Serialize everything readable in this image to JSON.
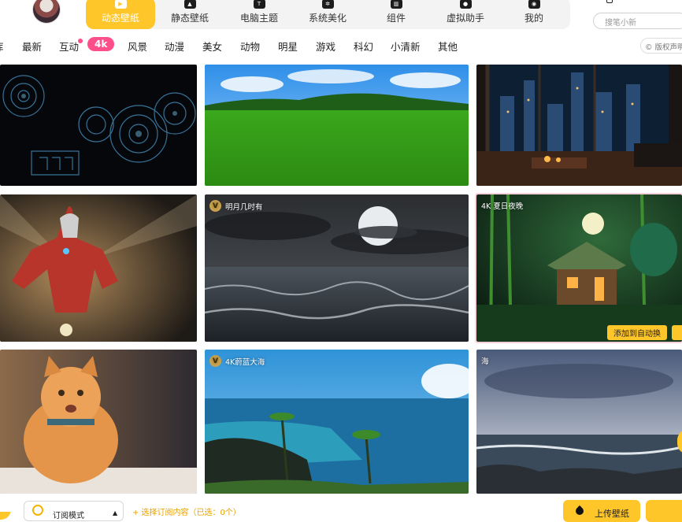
{
  "nav": {
    "items": [
      {
        "label": "动态壁纸",
        "icon": "play-icon",
        "active": true
      },
      {
        "label": "静态壁纸",
        "icon": "image-icon",
        "active": false
      },
      {
        "label": "电脑主题",
        "icon": "shirt-icon",
        "active": false
      },
      {
        "label": "系统美化",
        "icon": "gear-icon",
        "active": false
      },
      {
        "label": "组件",
        "icon": "widget-icon",
        "active": false
      },
      {
        "label": "虚拟助手",
        "icon": "paw-icon",
        "active": false
      },
      {
        "label": "我的",
        "icon": "user-icon",
        "active": false
      }
    ],
    "search_placeholder": "搜笔小新"
  },
  "categories": [
    "库",
    "最新",
    "互动",
    "4k",
    "风景",
    "动漫",
    "美女",
    "动物",
    "明星",
    "游戏",
    "科幻",
    "小清新",
    "其他"
  ],
  "active_category": "4k",
  "copyright_label": "版权声明",
  "tiles": [
    {
      "title": "",
      "vip": false,
      "scene": "tech-hud"
    },
    {
      "title": "",
      "vip": false,
      "scene": "green-field"
    },
    {
      "title": "",
      "vip": false,
      "scene": "night-city-room"
    },
    {
      "title": "",
      "vip": false,
      "scene": "ultraman"
    },
    {
      "title": "明月几时有",
      "vip": true,
      "scene": "moon-sea"
    },
    {
      "title": "4K 夏日夜晚",
      "vip": false,
      "scene": "forest-cabin",
      "action_label": "添加到自动换"
    },
    {
      "title": "",
      "vip": false,
      "scene": "orange-cat"
    },
    {
      "title": "4K蔚蓝大海",
      "vip": true,
      "scene": "blue-sea"
    },
    {
      "title": "海",
      "vip": false,
      "scene": "grey-sea"
    }
  ],
  "bottom": {
    "subscribe_mode": "订阅模式",
    "select_hint": "+ 选择订阅内容（已选：0个）",
    "upload_label": "上传壁纸"
  },
  "colors": {
    "accent": "#ffc629",
    "pink": "#ff4f8b"
  }
}
